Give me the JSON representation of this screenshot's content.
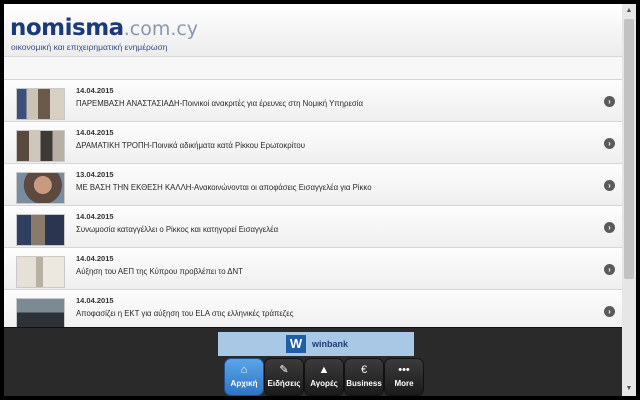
{
  "header": {
    "logo_main": "nomisma",
    "logo_domain": ".com.cy",
    "tagline": "οικονομική και επιχειρηματική ενημέρωση"
  },
  "news": [
    {
      "date": "14.04.2015",
      "title": "ΠΑΡΕΜΒΑΣΗ ΑΝΑΣΤΑΣΙΑΔΗ-Ποινικοί ανακριτές για έρευνες στη Νομική Υπηρεσία"
    },
    {
      "date": "14.04.2015",
      "title": "ΔΡΑΜΑΤΙΚΗ ΤΡΟΠΗ-Ποινικά αδικήματα κατά Ρίκκου Ερωτοκρίτου"
    },
    {
      "date": "13.04.2015",
      "title": "ΜΕ ΒΑΣΗ ΤΗΝ ΕΚΘΕΣΗ ΚΑΛΛΗ-Ανακοινώνονται οι αποφάσεις Εισαγγελέα για Ρίκκο"
    },
    {
      "date": "14.04.2015",
      "title": "Συνωμοσία καταγγέλλει ο Ρίκκος και κατηγορεί Εισαγγελέα"
    },
    {
      "date": "14.04.2015",
      "title": "Αύξηση του ΑΕΠ της Κύπρου προβλέπει το ΔΝΤ"
    },
    {
      "date": "14.04.2015",
      "title": "Αποφασίζει η ΕΚΤ για αύξηση του ELA στις ελληνικές τράπεζες"
    }
  ],
  "banner": {
    "brand": "winbank"
  },
  "nav": [
    {
      "label": "Αρχική",
      "icon": "⌂",
      "icon_name": "home-icon"
    },
    {
      "label": "Ειδήσεις",
      "icon": "✎",
      "icon_name": "news-icon"
    },
    {
      "label": "Αγορές",
      "icon": "▲",
      "icon_name": "markets-chart-icon"
    },
    {
      "label": "Business",
      "icon": "€",
      "icon_name": "euro-icon"
    },
    {
      "label": "More",
      "icon": "•••",
      "icon_name": "more-dots-icon"
    }
  ],
  "colors": {
    "brand": "#1a3a7a",
    "nav_active": "#3f8ad8",
    "footer": "#2a2a2a"
  }
}
